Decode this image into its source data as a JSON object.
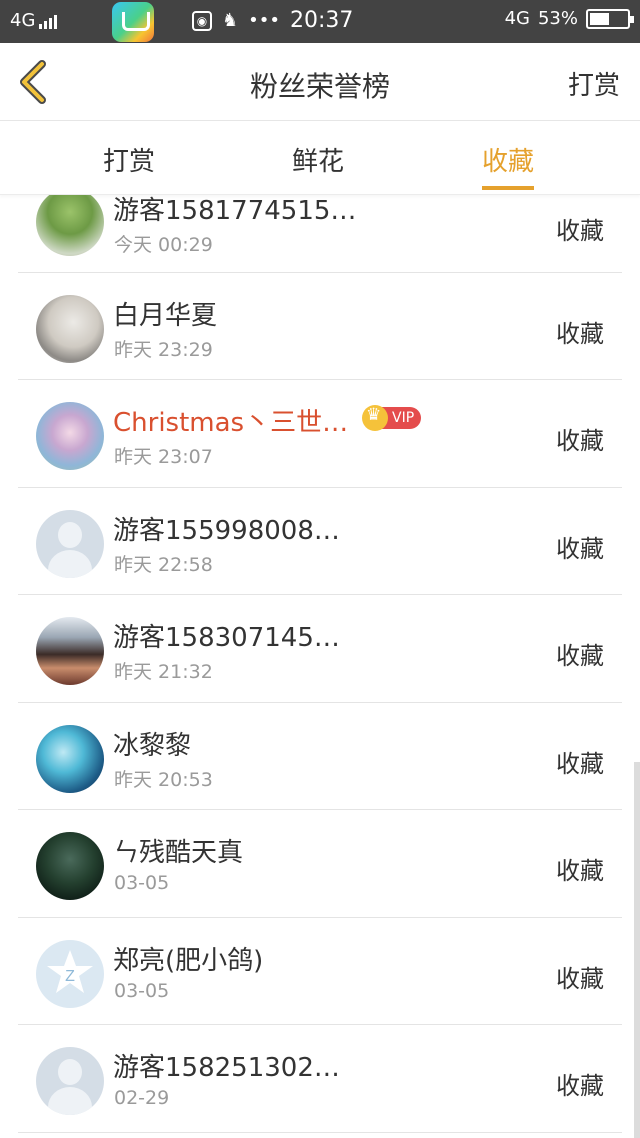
{
  "statusbar": {
    "network_left": "4G",
    "time": "20:37",
    "network_right": "4G",
    "battery_text": "53%",
    "battery_level": 0.53,
    "icons": [
      "app-store-icon",
      "globe-icon",
      "qq-icon",
      "more-dots-icon"
    ]
  },
  "nav": {
    "title": "粉丝荣誉榜",
    "right_action": "打赏",
    "back_icon": "chevron-left-icon",
    "accent": "#e5a12d"
  },
  "tabs": [
    {
      "label": "打赏",
      "active": false
    },
    {
      "label": "鲜花",
      "active": false
    },
    {
      "label": "收藏",
      "active": true
    }
  ],
  "list": [
    {
      "name": "游客1581774515…",
      "time": "今天 00:29",
      "action": "收藏",
      "avatar": "plant-photo"
    },
    {
      "name": "白月华夏",
      "time": "昨天 23:29",
      "action": "收藏",
      "avatar": "anime-girl-sketch"
    },
    {
      "name": "Christmas丶三世…",
      "time": "昨天 23:07",
      "action": "收藏",
      "avatar": "anime-girl-blossom",
      "vip": true,
      "vip_label": "VIP"
    },
    {
      "name": "游客155998008…",
      "time": "昨天 22:58",
      "action": "收藏",
      "avatar": "default-user"
    },
    {
      "name": "游客158307145…",
      "time": "昨天 21:32",
      "action": "收藏",
      "avatar": "group-photo"
    },
    {
      "name": "冰黎黎",
      "time": "昨天 20:53",
      "action": "收藏",
      "avatar": "anime-blue-hair"
    },
    {
      "name": "ㄣ残酷天真",
      "time": "03-05",
      "action": "收藏",
      "avatar": "night-scene"
    },
    {
      "name": "郑亮(肥小鸽)",
      "time": "03-05",
      "action": "收藏",
      "avatar": "qzone-star"
    },
    {
      "name": "游客158251302…",
      "time": "02-29",
      "action": "收藏",
      "avatar": "default-user"
    }
  ]
}
